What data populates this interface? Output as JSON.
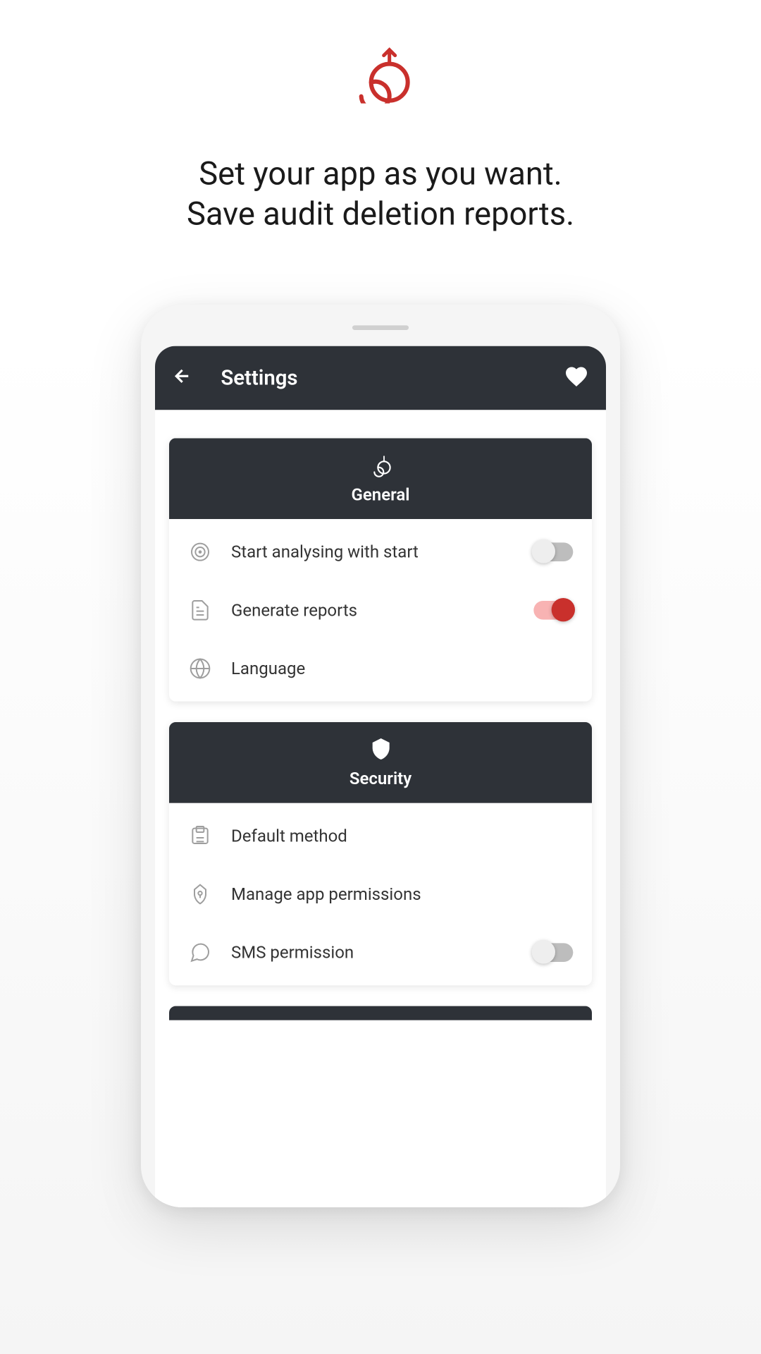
{
  "colors": {
    "brand": "#c9302c",
    "headerBg": "#2e3238"
  },
  "headline": {
    "line1": "Set your app as you want.",
    "line2": "Save audit deletion reports."
  },
  "appHeader": {
    "title": "Settings"
  },
  "sections": {
    "general": {
      "title": "General",
      "rows": {
        "analyse": {
          "label": "Start analysing with start",
          "toggle": false
        },
        "reports": {
          "label": "Generate reports",
          "toggle": true
        },
        "language": {
          "label": "Language"
        }
      }
    },
    "security": {
      "title": "Security",
      "rows": {
        "defaultMethod": {
          "label": "Default method"
        },
        "permissions": {
          "label": "Manage app permissions"
        },
        "sms": {
          "label": "SMS permission",
          "toggle": false
        }
      }
    }
  }
}
